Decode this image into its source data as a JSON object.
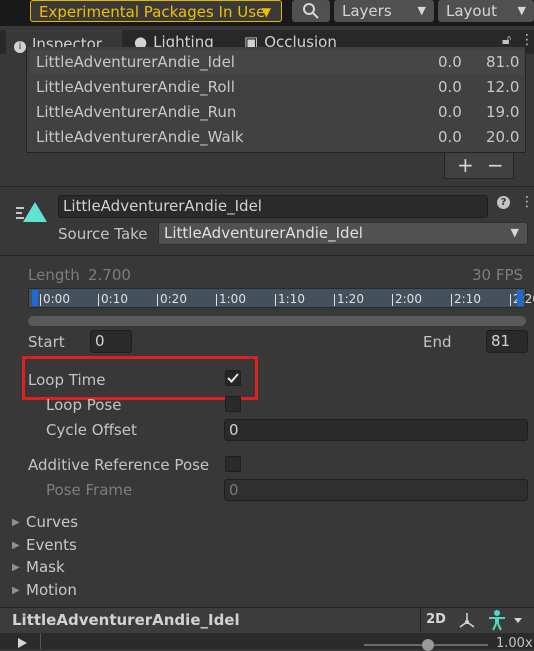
{
  "toolbar": {
    "packages_label": "Experimental Packages In Use",
    "layers_label": "Layers",
    "layout_label": "Layout"
  },
  "tabs": [
    {
      "label": "Inspector"
    },
    {
      "label": "Lighting"
    },
    {
      "label": "Occlusion"
    }
  ],
  "clips": [
    {
      "name": "LittleAdventurerAndie_Idel",
      "start": "0.0",
      "end": "81.0"
    },
    {
      "name": "LittleAdventurerAndie_Roll",
      "start": "0.0",
      "end": "12.0"
    },
    {
      "name": "LittleAdventurerAndie_Run",
      "start": "0.0",
      "end": "19.0"
    },
    {
      "name": "LittleAdventurerAndie_Walk",
      "start": "0.0",
      "end": "20.0"
    }
  ],
  "list_buttons": {
    "add": "+",
    "remove": "−"
  },
  "clip": {
    "name": "LittleAdventurerAndie_Idel",
    "source_take_label": "Source Take",
    "source_take": "LittleAdventurerAndie_Idel"
  },
  "length": {
    "label": "Length",
    "value": "2.700",
    "fps": "30 FPS"
  },
  "timeline_ticks": [
    "0:00",
    "0:10",
    "0:20",
    "1:00",
    "1:10",
    "1:20",
    "2:00",
    "2:10",
    "2:20"
  ],
  "range": {
    "start_label": "Start",
    "start": "0",
    "end_label": "End",
    "end": "81"
  },
  "loop_time": {
    "label": "Loop Time",
    "checked": true
  },
  "loop_pose": {
    "label": "Loop Pose"
  },
  "cycle_offset": {
    "label": "Cycle Offset",
    "value": "0"
  },
  "additive": {
    "label": "Additive Reference Pose"
  },
  "pose_frame": {
    "label": "Pose Frame",
    "value": "0"
  },
  "foldouts": [
    "Curves",
    "Events",
    "Mask",
    "Motion"
  ],
  "preview": {
    "name": "LittleAdventurerAndie_Idel",
    "mode_2d": "2D",
    "speed": "1.00x"
  },
  "colors": {
    "accent_warning": "#f0c000",
    "highlight_red": "#e02020",
    "clip_icon": "#5fe3d2"
  },
  "icons": [
    "search-icon",
    "lock-icon",
    "menu-icon",
    "help-icon",
    "more-icon",
    "checkmark-icon",
    "play-icon",
    "pivot-icon",
    "avatar-icon"
  ]
}
